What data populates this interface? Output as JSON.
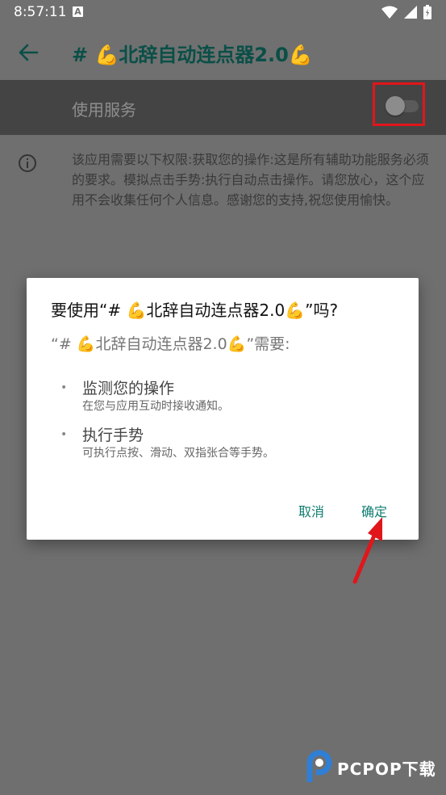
{
  "status_bar": {
    "time": "8:57:11",
    "sim_badge": "A",
    "icons": [
      "wifi-icon",
      "signal-icon",
      "battery-icon"
    ]
  },
  "app_bar": {
    "back_icon": "arrow-left-icon",
    "title": "# 💪北辞自动连点器2.0💪"
  },
  "service_row": {
    "label": "使用服务",
    "toggle_state": "off"
  },
  "description": {
    "icon": "info-icon",
    "text": "该应用需要以下权限:获取您的操作:这是所有辅助功能服务必须的要求。模拟点击手势:执行自动点击操作。请您放心，这个应用不会收集任何个人信息。感谢您的支持,祝您使用愉快。"
  },
  "dialog": {
    "title": "要使用“# 💪北辞自动连点器2.0💪”吗?",
    "subtitle": "“# 💪北辞自动连点器2.0💪”需要:",
    "permissions": [
      {
        "title": "监测您的操作",
        "desc": "在您与应用互动时接收通知。"
      },
      {
        "title": "执行手势",
        "desc": "可执行点按、滑动、双指张合等手势。"
      }
    ],
    "cancel_label": "取消",
    "ok_label": "确定"
  },
  "watermark": {
    "text": "PCPOP下载"
  },
  "colors": {
    "accent": "#0f7c6f",
    "title_color": "#0a4f47",
    "highlight_red": "#e0161b",
    "overlay_gray": "#6f6f6f"
  }
}
